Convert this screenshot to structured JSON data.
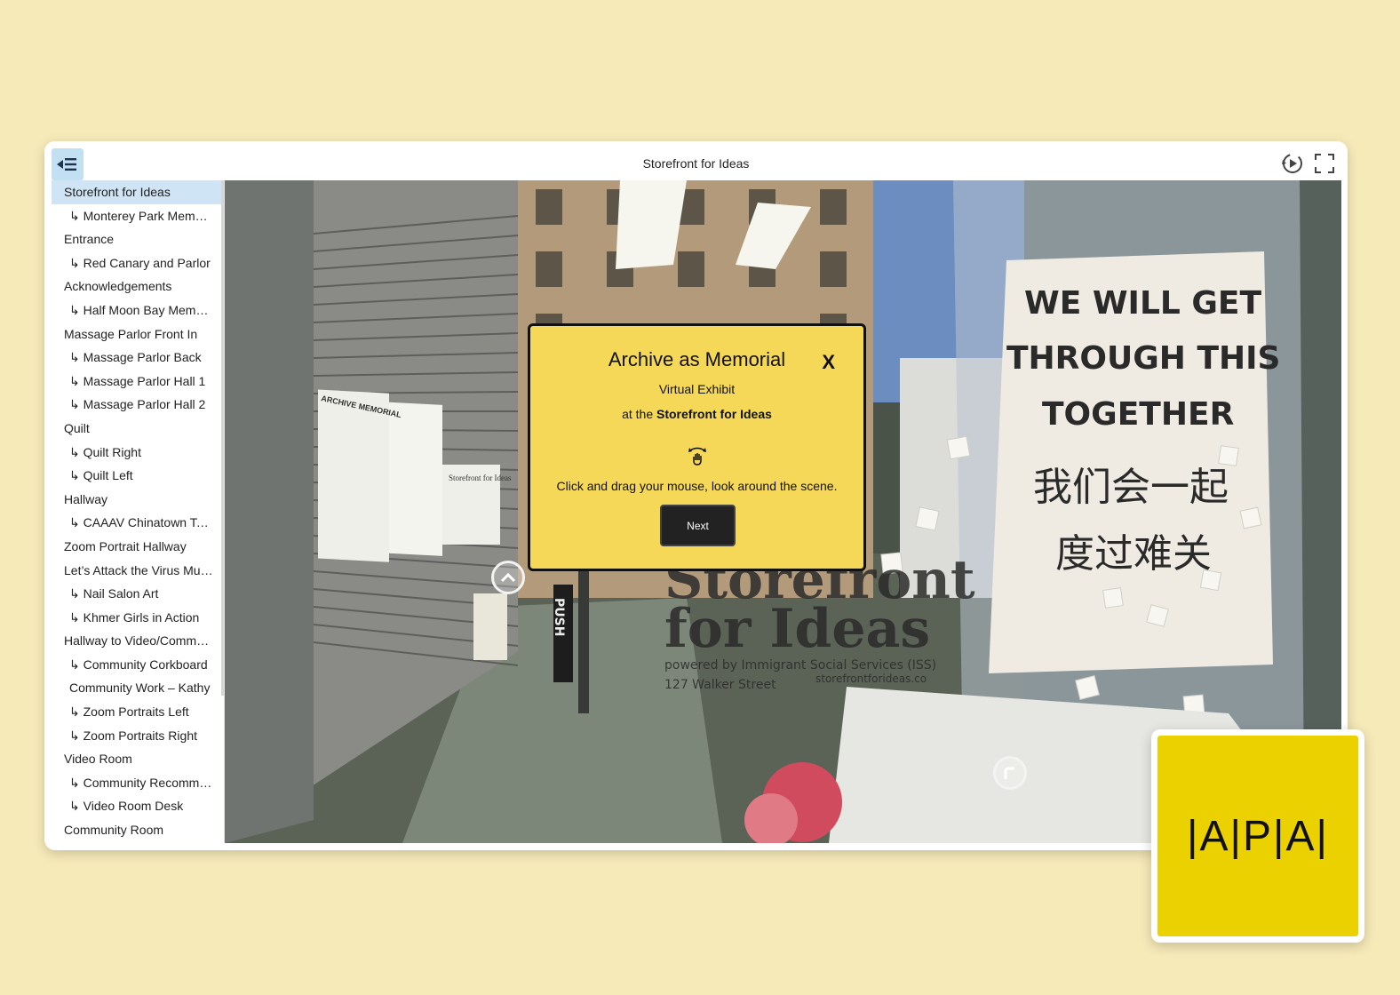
{
  "window": {
    "title": "Storefront for Ideas"
  },
  "toolbar": {
    "sidebar_toggle_icon": "sidebar-collapse-icon",
    "autorotate_icon": "autorotate-icon",
    "fullscreen_icon": "fullscreen-icon"
  },
  "sidebar": {
    "items": [
      {
        "label": "Storefront for Ideas",
        "level": 0,
        "active": true
      },
      {
        "label": "↳ Monterey Park Memorial",
        "level": 1
      },
      {
        "label": "Entrance",
        "level": 0
      },
      {
        "label": "↳ Red Canary and Parlor",
        "level": 1
      },
      {
        "label": "Acknowledgements",
        "level": 0
      },
      {
        "label": "↳ Half Moon Bay Memorial",
        "level": 1
      },
      {
        "label": "Massage Parlor Front In",
        "level": 0
      },
      {
        "label": "↳ Massage Parlor Back",
        "level": 1
      },
      {
        "label": "↳ Massage Parlor Hall 1",
        "level": 1
      },
      {
        "label": "↳ Massage Parlor Hall 2",
        "level": 1
      },
      {
        "label": "Quilt",
        "level": 0
      },
      {
        "label": "↳ Quilt Right",
        "level": 1
      },
      {
        "label": "↳ Quilt Left",
        "level": 1
      },
      {
        "label": "Hallway",
        "level": 0
      },
      {
        "label": "↳ CAAAV Chinatown Tenants",
        "level": 1
      },
      {
        "label": "Zoom Portrait Hallway",
        "level": 0
      },
      {
        "label": "Let’s Attack the Virus Mural",
        "level": 0
      },
      {
        "label": "↳ Nail Salon Art",
        "level": 1
      },
      {
        "label": "↳ Khmer Girls in Action",
        "level": 1
      },
      {
        "label": "Hallway to Video/Community",
        "level": 0
      },
      {
        "label": "↳ Community Corkboard",
        "level": 1
      },
      {
        "label": "Community Work – Kathy",
        "level": 1
      },
      {
        "label": "↳ Zoom Portraits Left",
        "level": 1
      },
      {
        "label": "↳ Zoom Portraits Right",
        "level": 1
      },
      {
        "label": "Video Room",
        "level": 0
      },
      {
        "label": "↳ Community Recommendations",
        "level": 1
      },
      {
        "label": "↳ Video Room Desk",
        "level": 1
      },
      {
        "label": "Community Room",
        "level": 0
      }
    ]
  },
  "scene": {
    "window_sign_lines": [
      "WE WILL GET",
      "THROUGH THIS",
      "TOGETHER",
      "我们会一起",
      "度过难关"
    ],
    "storefront_lines": [
      "Storefront",
      "for Ideas"
    ],
    "storefront_sub": [
      "powered by Immigrant Social Services (ISS)",
      "127 Walker Street",
      "storefrontforideas.co"
    ],
    "door_label": "PUSH",
    "poster_title": "Storefront for Ideas",
    "wall_sign": "ARCHIVE MEMORIAL"
  },
  "modal": {
    "title": "Archive as Memorial",
    "close_label": "X",
    "subtitle": "Virtual Exhibit",
    "at_prefix": "at the ",
    "at_venue": "Storefront for Ideas",
    "hint": "Click and drag your mouse, look around the scene.",
    "next_label": "Next"
  },
  "logo": {
    "text": "|A|P|A|"
  }
}
